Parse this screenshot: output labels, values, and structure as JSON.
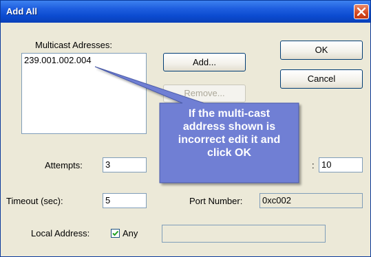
{
  "window": {
    "title": "Add All"
  },
  "multicast": {
    "label": "Multicast Adresses:",
    "items": [
      "239.001.002.004"
    ]
  },
  "buttons": {
    "add": "Add...",
    "remove": "Remove...",
    "ok": "OK",
    "cancel": "Cancel"
  },
  "attempts": {
    "label": "Attempts:",
    "value": "3"
  },
  "hidden_field": {
    "suffix": ":",
    "value": "10"
  },
  "timeout": {
    "label": "Timeout (sec):",
    "value": "5"
  },
  "port": {
    "label": "Port Number:",
    "value": "0xc002"
  },
  "local_address": {
    "label": "Local Address:",
    "any_label": "Any",
    "any_checked": true,
    "value": ""
  },
  "callout": {
    "lines": [
      "If the multi-cast",
      "address shown is",
      "incorrect edit it and"
    ],
    "last_prefix": "click ",
    "last_bold": "OK"
  },
  "colors": {
    "titlebar": "#0b4bd0",
    "dialog_bg": "#ece9d8",
    "callout_fill": "#6f7fd4",
    "close_button": "#d5481f"
  },
  "icons": {
    "close": "close-x-icon",
    "check": "checkmark-icon"
  }
}
